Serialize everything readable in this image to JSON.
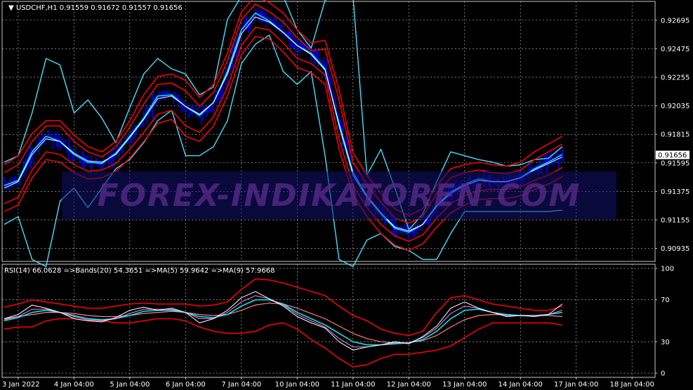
{
  "symbol_header": {
    "symbol": "USDCHF,H1",
    "open": "0.91559",
    "high": "0.91672",
    "low": "0.91557",
    "close": "0.91656"
  },
  "rsi_header": {
    "rsi": "RSI(14) 66.0628",
    "bands": "=>Bands(20) 54.3651",
    "ma5": "=>MA(5) 59.9642",
    "ma9": "=>MA(9) 57.9668"
  },
  "watermark": "FOREX-INDIKATOREN.COM",
  "colors": {
    "background": "#000000",
    "grid": "#c8c8c8",
    "candles": "#0000ff",
    "price_ma": "#00ffff",
    "fast_ma": "#ffffff",
    "inner_bands": "#ff0000",
    "outer_bands": "#40e0ff",
    "rsi_line": "#ffffff",
    "rsi_ma": "#00ffff",
    "rsi_bands": "#ff0000",
    "current_price_box": "#ffffff"
  },
  "chart_data": [
    {
      "type": "line",
      "name": "price-panel",
      "y_ticks": [
        "0.92695",
        "0.92475",
        "0.92255",
        "0.92035",
        "0.91815",
        "0.91595",
        "0.91375",
        "0.91155",
        "0.90935"
      ],
      "ylim": [
        0.90835,
        0.9284
      ],
      "current_price": "0.91656",
      "current_price_value": 0.91656,
      "x": [
        0,
        4,
        8,
        12,
        16,
        20,
        24,
        28,
        32,
        36,
        40,
        44,
        48,
        52,
        56,
        60,
        64,
        68,
        72,
        76,
        80,
        84,
        88,
        92,
        96,
        100,
        104,
        108,
        112,
        116,
        120,
        124,
        128,
        132,
        136,
        140,
        144,
        148,
        152,
        156,
        160
      ],
      "series": [
        {
          "key": "price",
          "values": [
            0.9142,
            0.9146,
            0.9168,
            0.918,
            0.9176,
            0.9166,
            0.916,
            0.9159,
            0.9167,
            0.918,
            0.9194,
            0.9211,
            0.9212,
            0.9203,
            0.9196,
            0.9206,
            0.923,
            0.9262,
            0.9275,
            0.9269,
            0.926,
            0.925,
            0.9244,
            0.9232,
            0.9188,
            0.915,
            0.9133,
            0.912,
            0.9109,
            0.9106,
            0.9112,
            0.9127,
            0.9137,
            0.9143,
            0.9147,
            0.9145,
            0.9145,
            0.9148,
            0.9155,
            0.916,
            0.9166
          ]
        },
        {
          "key": "fast_ma",
          "values": [
            0.914,
            0.9145,
            0.9166,
            0.9178,
            0.9176,
            0.9167,
            0.9161,
            0.916,
            0.9166,
            0.9179,
            0.9193,
            0.9209,
            0.9211,
            0.9203,
            0.9197,
            0.9206,
            0.9228,
            0.9259,
            0.9272,
            0.9268,
            0.926,
            0.925,
            0.9243,
            0.9231,
            0.919,
            0.9152,
            0.9134,
            0.9121,
            0.911,
            0.9107,
            0.9112,
            0.9126,
            0.9136,
            0.9142,
            0.9146,
            0.9145,
            0.9145,
            0.9148,
            0.9154,
            0.9159,
            0.9164
          ]
        },
        {
          "key": "red_upper_1",
          "values": [
            0.9152,
            0.9158,
            0.9176,
            0.9188,
            0.9188,
            0.9176,
            0.9168,
            0.9164,
            0.9172,
            0.9187,
            0.9205,
            0.922,
            0.9221,
            0.9215,
            0.9203,
            0.9214,
            0.9238,
            0.927,
            0.9282,
            0.9276,
            0.9268,
            0.9256,
            0.9246,
            0.9247,
            0.9208,
            0.916,
            0.9143,
            0.9129,
            0.9117,
            0.9113,
            0.9118,
            0.9136,
            0.9148,
            0.9152,
            0.9154,
            0.9152,
            0.9151,
            0.9154,
            0.9162,
            0.9168,
            0.9174
          ]
        },
        {
          "key": "red_lower_1",
          "values": [
            0.9128,
            0.9133,
            0.9154,
            0.9168,
            0.9166,
            0.9158,
            0.9153,
            0.9154,
            0.9159,
            0.917,
            0.9183,
            0.9197,
            0.92,
            0.9188,
            0.9183,
            0.9195,
            0.9218,
            0.925,
            0.9264,
            0.9262,
            0.9252,
            0.924,
            0.9236,
            0.9227,
            0.9178,
            0.9142,
            0.9125,
            0.9112,
            0.9103,
            0.9099,
            0.9104,
            0.9117,
            0.9128,
            0.9134,
            0.9138,
            0.9139,
            0.9139,
            0.9141,
            0.9146,
            0.915,
            0.9156
          ]
        },
        {
          "key": "red_upper_2",
          "values": [
            0.9158,
            0.9165,
            0.9182,
            0.9192,
            0.9192,
            0.9181,
            0.9172,
            0.9168,
            0.9176,
            0.9192,
            0.9212,
            0.9226,
            0.9228,
            0.9223,
            0.921,
            0.922,
            0.9244,
            0.9276,
            0.9288,
            0.9283,
            0.9275,
            0.9262,
            0.9252,
            0.9254,
            0.9216,
            0.9167,
            0.915,
            0.9136,
            0.9124,
            0.9119,
            0.9124,
            0.9142,
            0.9155,
            0.9158,
            0.916,
            0.9158,
            0.9157,
            0.916,
            0.9168,
            0.9174,
            0.918
          ]
        },
        {
          "key": "red_lower_2",
          "values": [
            0.9122,
            0.9127,
            0.9148,
            0.9162,
            0.916,
            0.9152,
            0.9147,
            0.9148,
            0.9153,
            0.9163,
            0.9176,
            0.919,
            0.9193,
            0.918,
            0.9176,
            0.9188,
            0.9211,
            0.9243,
            0.9257,
            0.9255,
            0.9245,
            0.9233,
            0.9229,
            0.922,
            0.917,
            0.9135,
            0.9118,
            0.9105,
            0.9096,
            0.9092,
            0.9097,
            0.911,
            0.9121,
            0.9127,
            0.9131,
            0.9132,
            0.9132,
            0.9134,
            0.9139,
            0.9143,
            0.9149
          ]
        },
        {
          "key": "cyan_upper",
          "values": [
            0.916,
            0.9165,
            0.9198,
            0.924,
            0.9235,
            0.9198,
            0.9208,
            0.9194,
            0.9175,
            0.9202,
            0.9228,
            0.924,
            0.9232,
            0.9228,
            0.9212,
            0.9218,
            0.927,
            0.9295,
            0.93,
            0.929,
            0.9288,
            0.9262,
            0.9248,
            0.9285,
            0.93,
            0.929,
            0.915,
            0.917,
            0.914,
            0.9108,
            0.912,
            0.9145,
            0.9168,
            0.9165,
            0.9162,
            0.916,
            0.9157,
            0.9158,
            0.9162,
            0.9163,
            0.9172
          ]
        },
        {
          "key": "cyan_lower",
          "values": [
            0.9112,
            0.9118,
            0.9085,
            0.9075,
            0.913,
            0.914,
            0.9125,
            0.914,
            0.9155,
            0.9162,
            0.9175,
            0.9192,
            0.92,
            0.9165,
            0.9165,
            0.9172,
            0.9192,
            0.9236,
            0.9251,
            0.9258,
            0.923,
            0.922,
            0.923,
            0.9165,
            0.9085,
            0.907,
            0.91,
            0.9105,
            0.9095,
            0.9092,
            0.9085,
            0.9085,
            0.9105,
            0.9122,
            0.9122,
            0.9122,
            0.9122,
            0.9122,
            0.9122,
            0.9122,
            0.9123
          ]
        }
      ]
    },
    {
      "type": "line",
      "name": "rsi-panel",
      "title": "RSI(14) 66.0628 =>Bands(20) 54.3651 =>MA(5) 59.9642 =>MA(9) 57.9668",
      "y_ticks": [
        "100",
        "70",
        "30",
        "0"
      ],
      "ylim": [
        -4,
        104
      ],
      "x": [
        0,
        4,
        8,
        12,
        16,
        20,
        24,
        28,
        32,
        36,
        40,
        44,
        48,
        52,
        56,
        60,
        64,
        68,
        72,
        76,
        80,
        84,
        88,
        92,
        96,
        100,
        104,
        108,
        112,
        116,
        120,
        124,
        128,
        132,
        136,
        140,
        144,
        148,
        152,
        156,
        160
      ],
      "series": [
        {
          "key": "rsi",
          "values": [
            52,
            56,
            65,
            62,
            58,
            52,
            50,
            49,
            53,
            60,
            63,
            60,
            62,
            58,
            48,
            52,
            60,
            72,
            78,
            71,
            64,
            54,
            48,
            43,
            30,
            22,
            25,
            27,
            30,
            28,
            35,
            45,
            62,
            68,
            62,
            58,
            54,
            55,
            54,
            56,
            66
          ]
        },
        {
          "key": "rsi_ma5",
          "values": [
            51,
            54,
            61,
            61,
            58,
            54,
            51,
            50,
            52,
            57,
            61,
            61,
            61,
            58,
            52,
            52,
            58,
            68,
            74,
            71,
            65,
            56,
            50,
            44,
            33,
            25,
            25,
            27,
            29,
            29,
            34,
            43,
            57,
            64,
            62,
            58,
            55,
            55,
            55,
            56,
            60
          ]
        },
        {
          "key": "rsi_ma9",
          "values": [
            50,
            53,
            58,
            60,
            58,
            55,
            52,
            51,
            52,
            55,
            59,
            60,
            60,
            58,
            54,
            53,
            56,
            64,
            70,
            70,
            66,
            58,
            52,
            46,
            38,
            30,
            27,
            27,
            28,
            29,
            32,
            40,
            52,
            60,
            61,
            58,
            56,
            55,
            55,
            56,
            58
          ]
        },
        {
          "key": "bands_mid",
          "values": [
            52,
            54,
            56,
            58,
            58,
            57,
            55,
            54,
            54,
            55,
            57,
            58,
            59,
            58,
            56,
            55,
            56,
            60,
            65,
            67,
            66,
            62,
            57,
            52,
            45,
            38,
            33,
            30,
            29,
            29,
            31,
            36,
            44,
            51,
            55,
            56,
            56,
            55,
            55,
            55,
            54
          ]
        },
        {
          "key": "bands_upper",
          "values": [
            63,
            66,
            70,
            68,
            66,
            64,
            62,
            62,
            64,
            66,
            67,
            66,
            66,
            66,
            64,
            65,
            68,
            80,
            90,
            89,
            86,
            82,
            78,
            74,
            64,
            55,
            50,
            42,
            38,
            36,
            40,
            58,
            72,
            74,
            70,
            66,
            64,
            62,
            60,
            60,
            64
          ]
        },
        {
          "key": "bands_lower",
          "values": [
            42,
            44,
            44,
            50,
            52,
            52,
            50,
            50,
            48,
            48,
            50,
            52,
            52,
            50,
            44,
            40,
            38,
            38,
            40,
            46,
            48,
            42,
            32,
            24,
            14,
            6,
            8,
            14,
            18,
            18,
            20,
            22,
            26,
            34,
            42,
            48,
            48,
            48,
            48,
            48,
            46
          ]
        }
      ]
    }
  ],
  "x_axis": {
    "labels": [
      {
        "x": 4,
        "text": "3 Jan 2022"
      },
      {
        "x": 20,
        "text": "4 Jan 04:00"
      },
      {
        "x": 36,
        "text": "5 Jan 04:00"
      },
      {
        "x": 52,
        "text": "6 Jan 04:00"
      },
      {
        "x": 68,
        "text": "7 Jan 04:00"
      },
      {
        "x": 84,
        "text": "10 Jan 04:00"
      },
      {
        "x": 100,
        "text": "11 Jan 04:00"
      },
      {
        "x": 116,
        "text": "12 Jan 04:00"
      },
      {
        "x": 132,
        "text": "13 Jan 04:00"
      },
      {
        "x": 148,
        "text": "14 Jan 04:00"
      },
      {
        "x": 164,
        "text": "17 Jan 04:00"
      },
      {
        "x": 180,
        "text": "18 Jan 04:00"
      }
    ],
    "xmax": 186
  }
}
